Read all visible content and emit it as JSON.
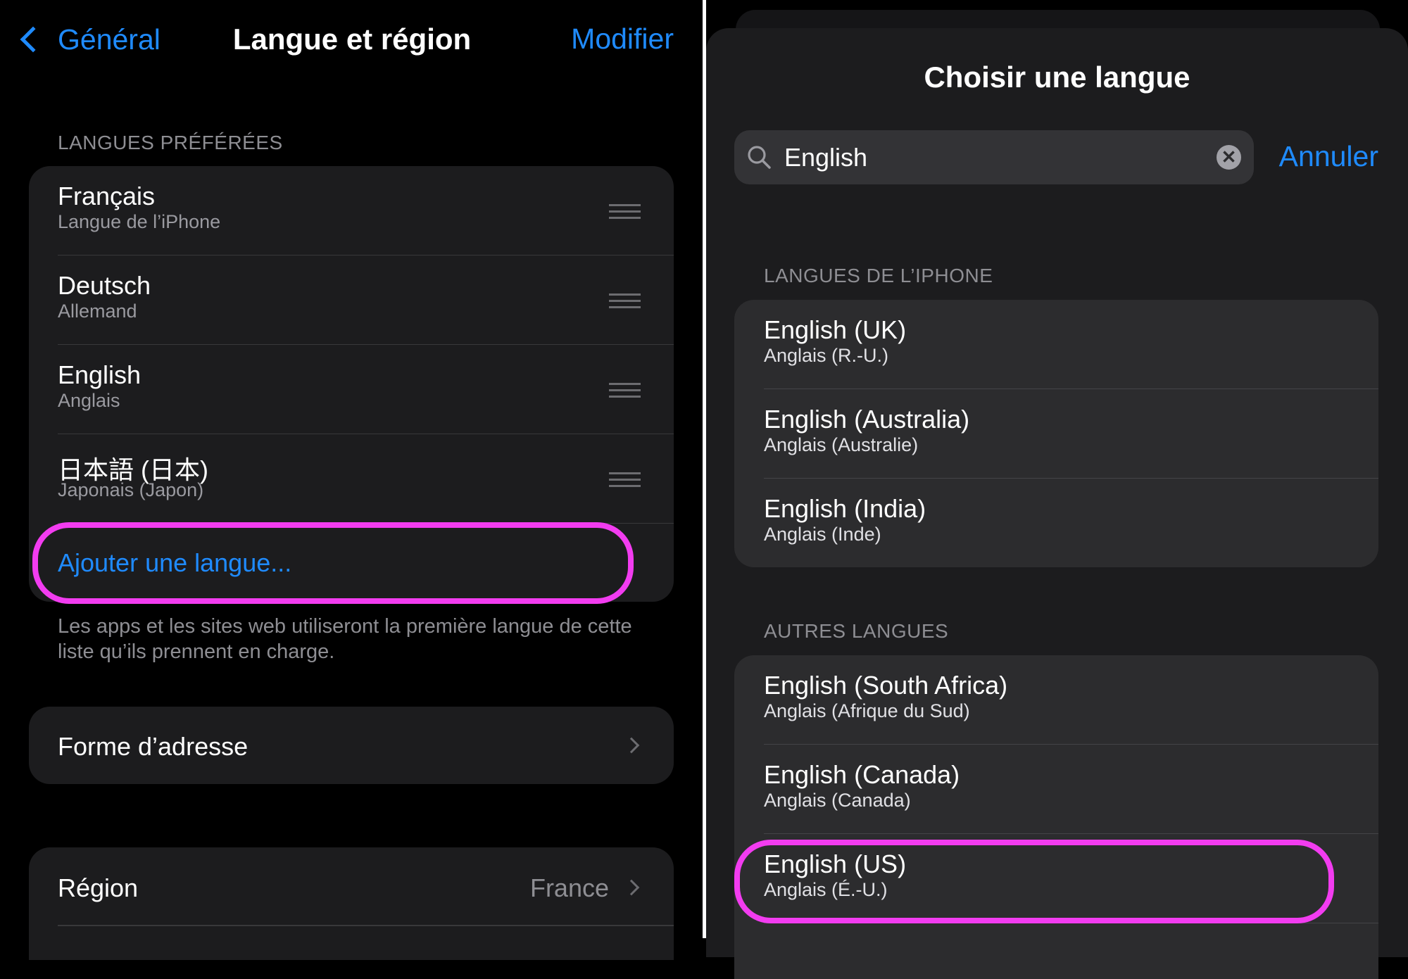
{
  "left": {
    "nav": {
      "back_label": "Général",
      "title": "Langue et région",
      "edit_label": "Modifier"
    },
    "preferred_header": "LANGUES PRÉFÉRÉES",
    "languages": [
      {
        "name": "Français",
        "subtitle": "Langue de l’iPhone"
      },
      {
        "name": "Deutsch",
        "subtitle": "Allemand"
      },
      {
        "name": "English",
        "subtitle": "Anglais"
      },
      {
        "name": "日本語 (日本)",
        "subtitle": "Japonais (Japon)"
      }
    ],
    "add_language": "Ajouter une langue...",
    "footer": "Les apps et les sites web utiliseront la première langue de cette liste qu’ils prennent en charge.",
    "address_form": "Forme d’adresse",
    "region": {
      "label": "Région",
      "value": "France"
    }
  },
  "right": {
    "title": "Choisir une langue",
    "search": {
      "value": "English",
      "cancel_label": "Annuler"
    },
    "iphone_header": "LANGUES DE L’IPHONE",
    "iphone_languages": [
      {
        "name": "English (UK)",
        "subtitle": "Anglais (R.-U.)"
      },
      {
        "name": "English (Australia)",
        "subtitle": "Anglais (Australie)"
      },
      {
        "name": "English (India)",
        "subtitle": "Anglais (Inde)"
      }
    ],
    "other_header": "AUTRES LANGUES",
    "other_languages": [
      {
        "name": "English (South Africa)",
        "subtitle": "Anglais (Afrique du Sud)"
      },
      {
        "name": "English (Canada)",
        "subtitle": "Anglais (Canada)"
      },
      {
        "name": "English (US)",
        "subtitle": "Anglais (É.-U.)"
      }
    ]
  },
  "colors": {
    "accent": "#1f8bff",
    "highlight": "#f23cf0",
    "card": "#1c1c1e"
  }
}
